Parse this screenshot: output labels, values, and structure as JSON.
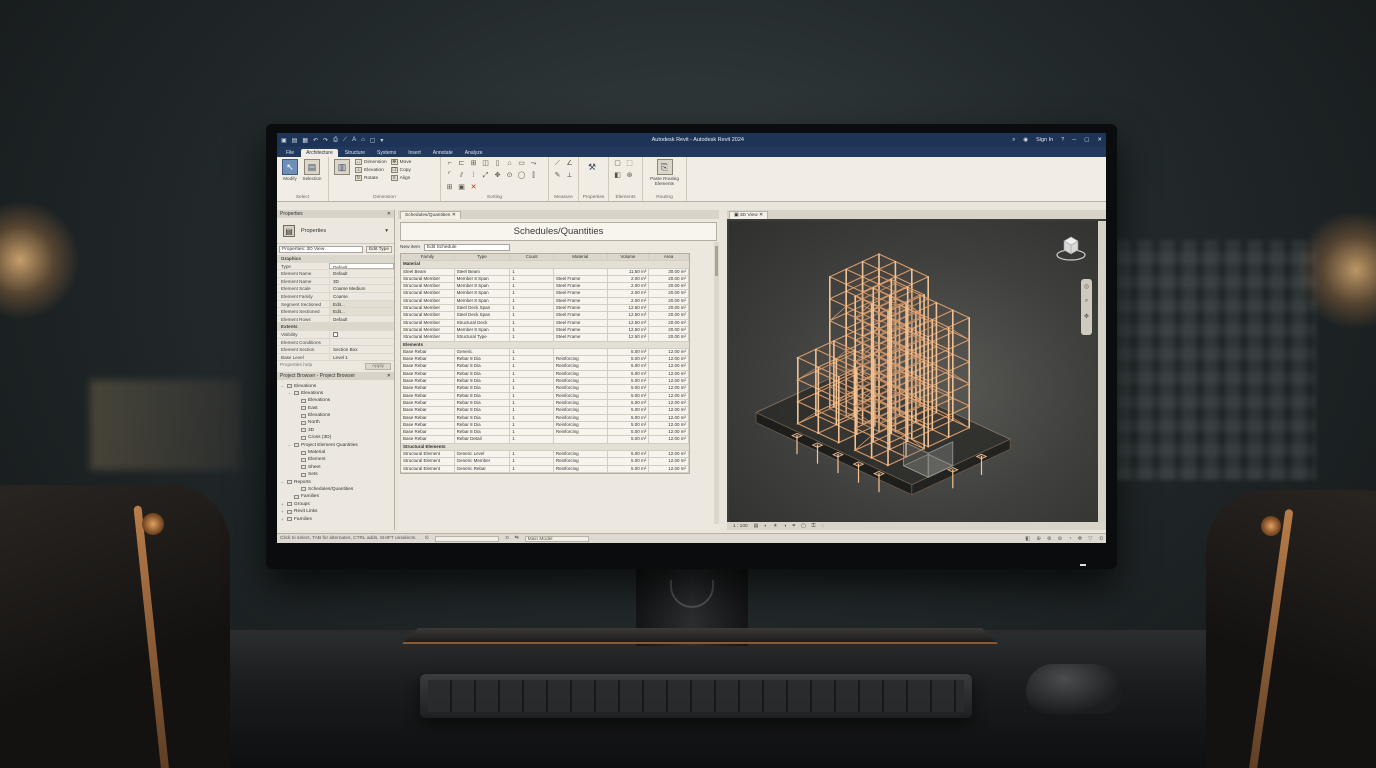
{
  "app": {
    "title": "Autodesk Revit - Autodesk Revit 2024",
    "user": "Sign In",
    "help": "?"
  },
  "ribbon": {
    "tabs": [
      "File",
      "Architecture",
      "Structure",
      "Systems",
      "Insert",
      "Annotate",
      "Analyze"
    ],
    "active_tab_index": 1,
    "groups": {
      "select": {
        "label": "Select",
        "button": "Modify"
      },
      "selection": {
        "label": "Selection",
        "button": "Selection"
      },
      "dimension": {
        "label": "Dimension",
        "items": [
          "Dimension",
          "Elevation",
          "Rotate",
          "Move",
          "Copy",
          "Align"
        ]
      },
      "sorting": {
        "label": "Sorting"
      },
      "measure": {
        "label": "Measure"
      },
      "properties": {
        "label": "Properties"
      },
      "elements": {
        "label": "Elements"
      },
      "routing": {
        "label": "Routing",
        "button": "Paste Routing Elements"
      }
    }
  },
  "properties": {
    "panel_title": "Properties",
    "type_name": "Properties",
    "selector": "Properties: 3D View",
    "edit_type": "Edit Type",
    "rows": [
      {
        "k": "Graphics",
        "v": "",
        "cat": true
      },
      {
        "k": "Type",
        "v": "Default",
        "style": "box"
      },
      {
        "k": "Element Name",
        "v": "Default"
      },
      {
        "k": "Element Name",
        "v": "3D"
      },
      {
        "k": "Element Scale",
        "v": "Coarse Medium"
      },
      {
        "k": "Element Family",
        "v": "Coarse"
      },
      {
        "k": "Segment Sectioned",
        "v": "Edit...",
        "style": "btn"
      },
      {
        "k": "Element Sectioned",
        "v": "Edit...",
        "style": "btn"
      },
      {
        "k": "Element Rows",
        "v": "Default"
      },
      {
        "k": "Extents",
        "v": "",
        "cat": true
      },
      {
        "k": "Visibility",
        "v": "",
        "check": true
      },
      {
        "k": "Element Conditions",
        "v": ""
      },
      {
        "k": "Element Section",
        "v": "Section Box"
      },
      {
        "k": "Base Level",
        "v": "Level 1"
      }
    ],
    "help_link": "Properties help",
    "apply": "Apply"
  },
  "project_browser": {
    "title": "Project Browser - Project Browser",
    "items": [
      {
        "indent": 0,
        "toggle": "−",
        "label": "Elevations"
      },
      {
        "indent": 1,
        "toggle": "−",
        "label": "Elevations"
      },
      {
        "indent": 2,
        "toggle": "",
        "label": "Elevations"
      },
      {
        "indent": 2,
        "toggle": "",
        "label": "East"
      },
      {
        "indent": 2,
        "toggle": "",
        "label": "Elevations"
      },
      {
        "indent": 2,
        "toggle": "",
        "label": "North"
      },
      {
        "indent": 2,
        "toggle": "",
        "label": "3D"
      },
      {
        "indent": 2,
        "toggle": "",
        "label": "Cross (3D)"
      },
      {
        "indent": 1,
        "toggle": "−",
        "label": "Project Element Quantities"
      },
      {
        "indent": 2,
        "toggle": "",
        "label": "Material"
      },
      {
        "indent": 2,
        "toggle": "",
        "label": "Element"
      },
      {
        "indent": 2,
        "toggle": "",
        "label": "Sheet"
      },
      {
        "indent": 2,
        "toggle": "",
        "label": "Sets"
      },
      {
        "indent": 0,
        "toggle": "−",
        "label": "Reports"
      },
      {
        "indent": 2,
        "toggle": "",
        "label": "Schedules/Quantities"
      },
      {
        "indent": 1,
        "toggle": "",
        "label": "Families"
      },
      {
        "indent": 0,
        "toggle": "+",
        "label": "Groups"
      },
      {
        "indent": 0,
        "toggle": "+",
        "label": "Revit Links"
      },
      {
        "indent": 0,
        "toggle": "+",
        "label": "Families"
      }
    ]
  },
  "schedule": {
    "tab": "Schedules/Quantities",
    "title": "Schedules/Quantities",
    "filter_label": "New item",
    "filter_value": "Edit Schedule",
    "columns": [
      "Family",
      "Type",
      "Count",
      "Material",
      "Volume",
      "Area"
    ],
    "groups": [
      {
        "name": "Material",
        "rows": [
          [
            "Steel Beam",
            "Steel Beam",
            "1",
            "",
            "11.50 m³",
            "30.00 m²"
          ],
          [
            "Structural Member",
            "Member 8 Span",
            "1",
            "Steel Frame",
            "2.00 m³",
            "20.00 m²"
          ],
          [
            "Structural Member",
            "Member 8 Span",
            "1",
            "Steel Frame",
            "2.00 m³",
            "20.00 m²"
          ],
          [
            "Structural Member",
            "Member 8 Span",
            "1",
            "Steel Frame",
            "2.00 m³",
            "20.00 m²"
          ],
          [
            "Structural Member",
            "Member 8 Span",
            "1",
            "Steel Frame",
            "2.00 m³",
            "20.00 m²"
          ],
          [
            "Structural Member",
            "Steel Deck Span",
            "1",
            "Steel Frame",
            "12.50 m³",
            "20.00 m²"
          ],
          [
            "Structural Member",
            "Steel Deck Span",
            "1",
            "Steel Frame",
            "12.50 m³",
            "20.00 m²"
          ],
          [
            "Structural Member",
            "Structural Deck",
            "1",
            "Steel Frame",
            "12.50 m³",
            "20.00 m²"
          ],
          [
            "Structural Member",
            "Member 8 Span",
            "1",
            "Steel Frame",
            "12.50 m³",
            "20.00 m²"
          ],
          [
            "Structural Member",
            "Structural Type",
            "1",
            "Steel Frame",
            "12.50 m³",
            "20.00 m²"
          ]
        ]
      },
      {
        "name": "Elements",
        "rows": [
          [
            "Base Rebar",
            "Generic",
            "1",
            "",
            "5.00 m³",
            "12.00 m²"
          ],
          [
            "Base Rebar",
            "Rebar 8 Dia",
            "1",
            "Reinforcing",
            "5.00 m³",
            "12.00 m²"
          ],
          [
            "Base Rebar",
            "Rebar 8 Dia",
            "1",
            "Reinforcing",
            "5.00 m³",
            "12.00 m²"
          ],
          [
            "Base Rebar",
            "Rebar 8 Dia",
            "1",
            "Reinforcing",
            "5.00 m³",
            "12.00 m²"
          ],
          [
            "Base Rebar",
            "Rebar 8 Dia",
            "1",
            "Reinforcing",
            "5.00 m³",
            "12.00 m²"
          ],
          [
            "Base Rebar",
            "Rebar 8 Dia",
            "1",
            "Reinforcing",
            "5.00 m³",
            "12.00 m²"
          ],
          [
            "Base Rebar",
            "Rebar 8 Dia",
            "1",
            "Reinforcing",
            "5.00 m³",
            "12.00 m²"
          ],
          [
            "Base Rebar",
            "Rebar 8 Dia",
            "1",
            "Reinforcing",
            "5.00 m³",
            "12.00 m²"
          ],
          [
            "Base Rebar",
            "Rebar 8 Dia",
            "1",
            "Reinforcing",
            "5.00 m³",
            "12.00 m²"
          ],
          [
            "Base Rebar",
            "Rebar 8 Dia",
            "1",
            "Reinforcing",
            "5.00 m³",
            "12.00 m²"
          ],
          [
            "Base Rebar",
            "Rebar 8 Dia",
            "1",
            "Reinforcing",
            "5.00 m³",
            "12.00 m²"
          ],
          [
            "Base Rebar",
            "Rebar 8 Dia",
            "1",
            "Reinforcing",
            "5.00 m³",
            "12.00 m²"
          ],
          [
            "Base Rebar",
            "Rebar Detail",
            "1",
            "",
            "5.00 m³",
            "12.00 m²"
          ]
        ]
      },
      {
        "name": "Structural Elements",
        "rows": [
          [
            "Structural Element",
            "Generic Level",
            "1",
            "Reinforcing",
            "5.00 m³",
            "12.00 m²"
          ],
          [
            "Structural Element",
            "Generic Member",
            "1",
            "Reinforcing",
            "5.00 m³",
            "12.00 m²"
          ],
          [
            "Structural Element",
            "Generic Rebar",
            "1",
            "Reinforcing",
            "5.00 m³",
            "12.00 m²"
          ]
        ]
      }
    ]
  },
  "view3d": {
    "tab": "3D View",
    "scale": "1 : 100"
  },
  "status": {
    "text": "Click to select, TAB for alternates, CTRL adds, SHIFT unselects.",
    "model": "Main Model",
    "zero": ":0"
  },
  "colors": {
    "titlebar": "#1e3456",
    "frame_line": "#d89a6a",
    "frame_glow": "#f2c293"
  }
}
